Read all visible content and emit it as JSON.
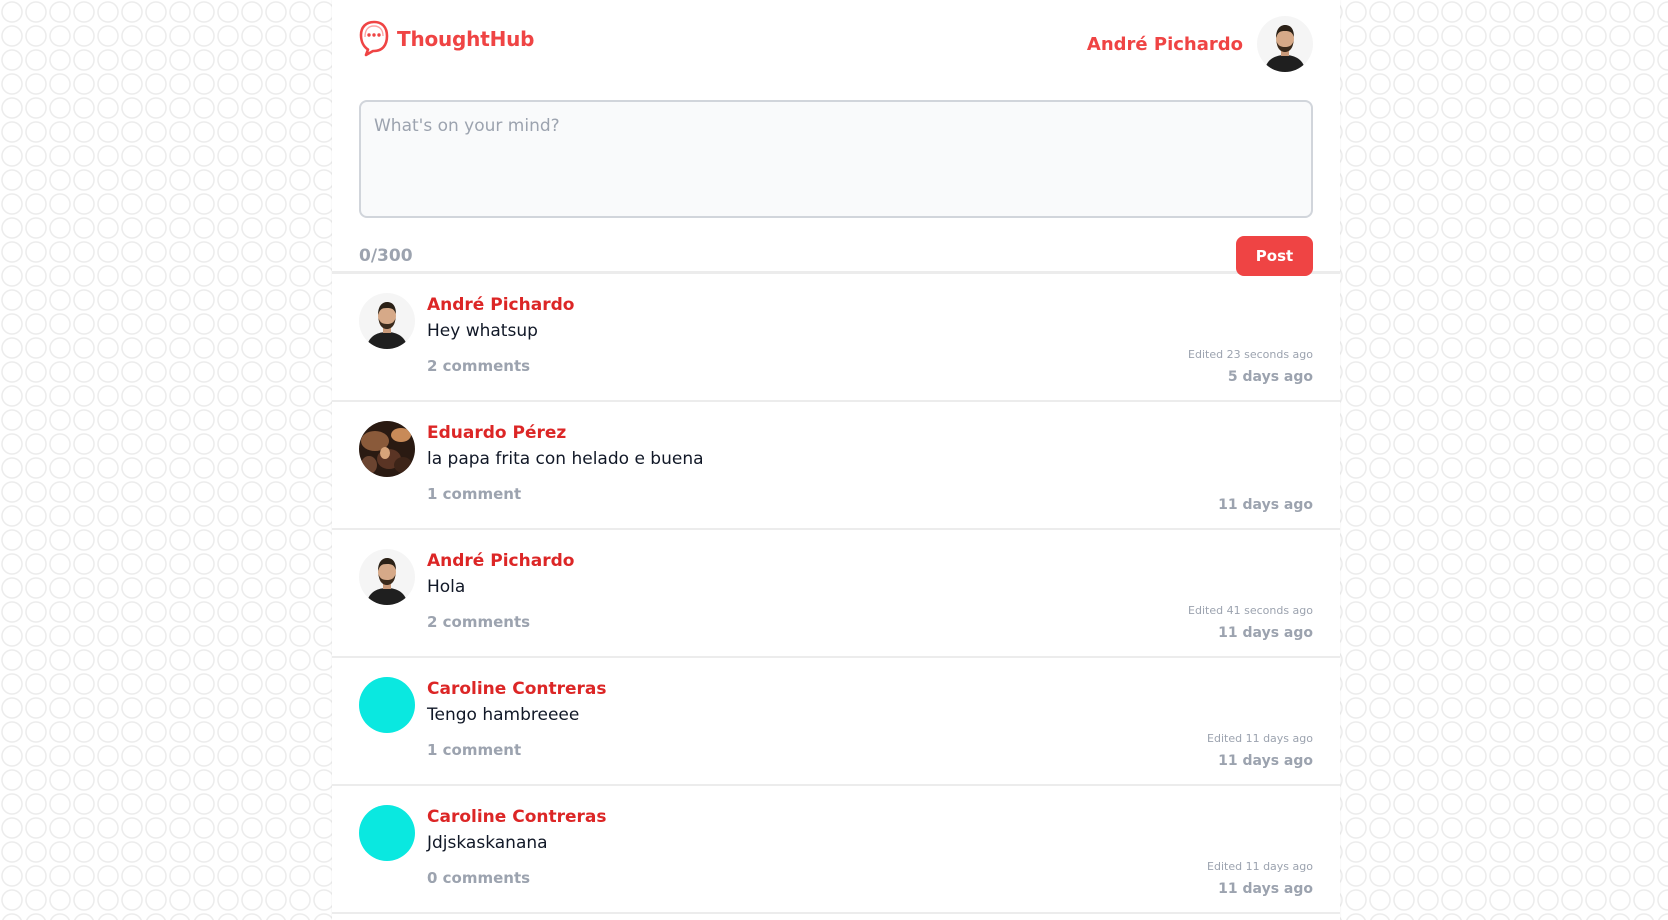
{
  "app": {
    "name": "ThoughtHub",
    "brand_color": "#ef4444",
    "logo_icon": "speech-bubble-icon"
  },
  "header": {
    "user_name": "André Pichardo",
    "avatar": "photo-avatar"
  },
  "composer": {
    "placeholder": "What's on your mind?",
    "value": "",
    "char_count": "0/300",
    "post_label": "Post"
  },
  "posts": [
    {
      "author": "André Pichardo",
      "content": "Hey whatsup",
      "comments": "2 comments",
      "edited": "Edited 23 seconds ago",
      "time": "5 days ago",
      "avatar": "photo-man"
    },
    {
      "author": "Eduardo Pérez",
      "content": "la papa frita con helado e buena",
      "comments": "1 comment",
      "edited": "",
      "time": "11 days ago",
      "avatar": "photo-scene"
    },
    {
      "author": "André Pichardo",
      "content": "Hola",
      "comments": "2 comments",
      "edited": "Edited 41 seconds ago",
      "time": "11 days ago",
      "avatar": "photo-man"
    },
    {
      "author": "Caroline Contreras",
      "content": "Tengo hambreeee",
      "comments": "1 comment",
      "edited": "Edited 11 days ago",
      "time": "11 days ago",
      "avatar": "solid-cyan",
      "avatar_color": "#0ae8e0"
    },
    {
      "author": "Caroline Contreras",
      "content": "Jdjskaskanana",
      "comments": "0 comments",
      "edited": "Edited 11 days ago",
      "time": "11 days ago",
      "avatar": "solid-cyan",
      "avatar_color": "#0ae8e0"
    }
  ]
}
